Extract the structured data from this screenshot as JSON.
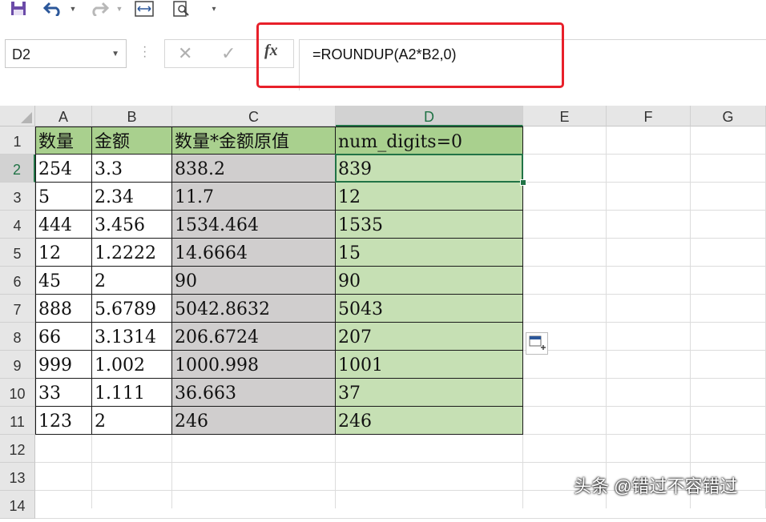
{
  "formula_bar": {
    "name_box": "D2",
    "formula": "=ROUNDUP(A2*B2,0)",
    "fx_label": "fx"
  },
  "columns": [
    "A",
    "B",
    "C",
    "D",
    "E",
    "F",
    "G"
  ],
  "rows": [
    "1",
    "2",
    "3",
    "4",
    "5",
    "6",
    "7",
    "8",
    "9",
    "10",
    "11",
    "12",
    "13",
    "14"
  ],
  "table": {
    "headers": [
      "数量",
      "金额",
      "数量*金额原值",
      "num_digits=0"
    ],
    "rows": [
      [
        "254",
        "3.3",
        "838.2",
        "839"
      ],
      [
        "5",
        "2.34",
        "11.7",
        "12"
      ],
      [
        "444",
        "3.456",
        "1534.464",
        "1535"
      ],
      [
        "12",
        "1.2222",
        "14.6664",
        "15"
      ],
      [
        "45",
        "2",
        "90",
        "90"
      ],
      [
        "888",
        "5.6789",
        "5042.8632",
        "5043"
      ],
      [
        "66",
        "3.1314",
        "206.6724",
        "207"
      ],
      [
        "999",
        "1.002",
        "1000.998",
        "1001"
      ],
      [
        "33",
        "1.111",
        "36.663",
        "37"
      ],
      [
        "123",
        "2",
        "246",
        "246"
      ]
    ]
  },
  "colors": {
    "header_fill": "#a9d08e",
    "col_c_fill": "#d0cece",
    "col_d_fill": "#c6e0b4",
    "highlight_border": "#e8202a",
    "excel_green": "#217346"
  },
  "watermark": "头条 @错过不容错过"
}
